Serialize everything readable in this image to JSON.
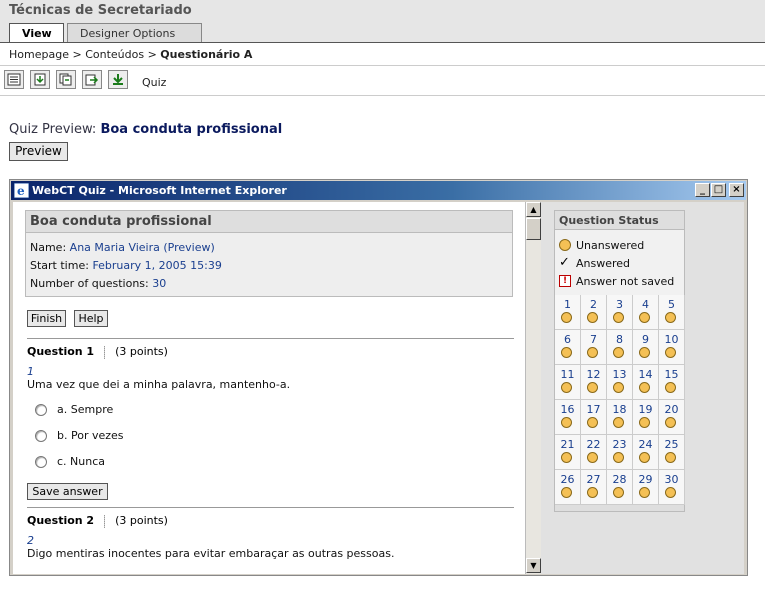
{
  "course": {
    "title": "Técnicas de Secretariado",
    "tabs": [
      "View",
      "Designer Options"
    ]
  },
  "breadcrumb": {
    "items": [
      "Homepage",
      "Conteúdos"
    ],
    "separator": ">",
    "current": "Questionário A"
  },
  "toolbar": {
    "icons": [
      "list-icon",
      "import-icon",
      "copy-icon",
      "export-icon",
      "download-icon"
    ],
    "label": "Quiz"
  },
  "preview": {
    "heading_label": "Quiz Preview:",
    "quiz_name": "Boa conduta profissional",
    "button_label": "Preview"
  },
  "window": {
    "title": "WebCT Quiz - Microsoft Internet Explorer",
    "controls": [
      "_",
      "□",
      "×"
    ]
  },
  "quiz": {
    "title": "Boa conduta profissional",
    "name_label": "Name:",
    "name_value": "Ana Maria Vieira (Preview)",
    "start_label": "Start time:",
    "start_value": "February 1, 2005 15:39",
    "count_label": "Number of questions:",
    "count_value": "30",
    "finish_label": "Finish",
    "help_label": "Help",
    "save_label": "Save answer",
    "questions": [
      {
        "label": "Question 1",
        "points": "(3 points)",
        "number": "1",
        "text": "Uma vez que dei a minha palavra, mantenho-a.",
        "options": [
          {
            "letter": "a.",
            "text": "Sempre"
          },
          {
            "letter": "b.",
            "text": "Por vezes"
          },
          {
            "letter": "c.",
            "text": "Nunca"
          }
        ]
      },
      {
        "label": "Question 2",
        "points": "(3 points)",
        "number": "2",
        "text": "Digo mentiras inocentes para evitar embaraçar as outras pessoas."
      }
    ]
  },
  "status": {
    "title": "Question Status",
    "legend": [
      "Unanswered",
      "Answered",
      "Answer not saved"
    ],
    "numbers": [
      "1",
      "2",
      "3",
      "4",
      "5",
      "6",
      "7",
      "8",
      "9",
      "10",
      "11",
      "12",
      "13",
      "14",
      "15",
      "16",
      "17",
      "18",
      "19",
      "20",
      "21",
      "22",
      "23",
      "24",
      "25",
      "26",
      "27",
      "28",
      "29",
      "30"
    ]
  },
  "colors": {
    "titlebar": "#0a246a",
    "link_blue": "#1a3f8f",
    "unanswered_dot": "#f4c055"
  }
}
